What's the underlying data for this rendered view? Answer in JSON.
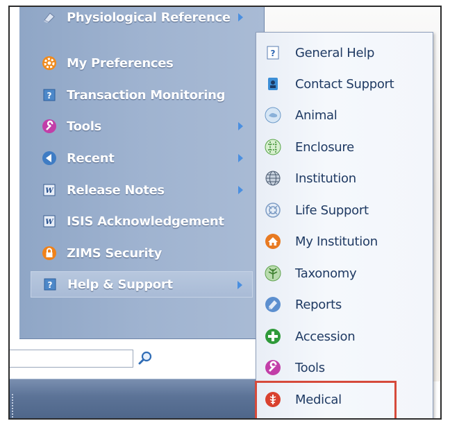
{
  "menu": {
    "items": [
      {
        "label": "Physiological Reference",
        "icon": "eraser-icon",
        "has_submenu": true
      },
      {
        "label": "My Preferences",
        "icon": "gear-icon",
        "has_submenu": false
      },
      {
        "label": "Transaction Monitoring",
        "icon": "help-doc-icon",
        "has_submenu": false
      },
      {
        "label": "Tools",
        "icon": "wrench-icon",
        "has_submenu": true
      },
      {
        "label": "Recent",
        "icon": "back-arrow-icon",
        "has_submenu": true
      },
      {
        "label": "Release Notes",
        "icon": "word-doc-icon",
        "has_submenu": true
      },
      {
        "label": "ISIS Acknowledgement",
        "icon": "word-doc-icon",
        "has_submenu": false
      },
      {
        "label": "ZIMS Security",
        "icon": "lock-icon",
        "has_submenu": false
      },
      {
        "label": "Help & Support",
        "icon": "help-doc-icon",
        "has_submenu": true,
        "active": true
      }
    ]
  },
  "submenu": {
    "items": [
      {
        "label": "General Help",
        "icon": "question-doc-icon"
      },
      {
        "label": "Contact Support",
        "icon": "contact-card-icon"
      },
      {
        "label": "Animal",
        "icon": "animal-icon"
      },
      {
        "label": "Enclosure",
        "icon": "enclosure-icon"
      },
      {
        "label": "Institution",
        "icon": "globe-icon"
      },
      {
        "label": "Life Support",
        "icon": "life-support-icon"
      },
      {
        "label": "My Institution",
        "icon": "home-icon"
      },
      {
        "label": "Taxonomy",
        "icon": "taxonomy-icon"
      },
      {
        "label": "Reports",
        "icon": "reports-icon"
      },
      {
        "label": "Accession",
        "icon": "plus-icon"
      },
      {
        "label": "Tools",
        "icon": "wrench-icon"
      },
      {
        "label": "Medical",
        "icon": "medical-icon",
        "highlighted": true
      }
    ]
  },
  "search": {
    "value": "",
    "placeholder": ""
  },
  "colors": {
    "highlight_border": "#d64a3b",
    "menu_text": "#ffffff",
    "submenu_text": "#1f3a63"
  }
}
